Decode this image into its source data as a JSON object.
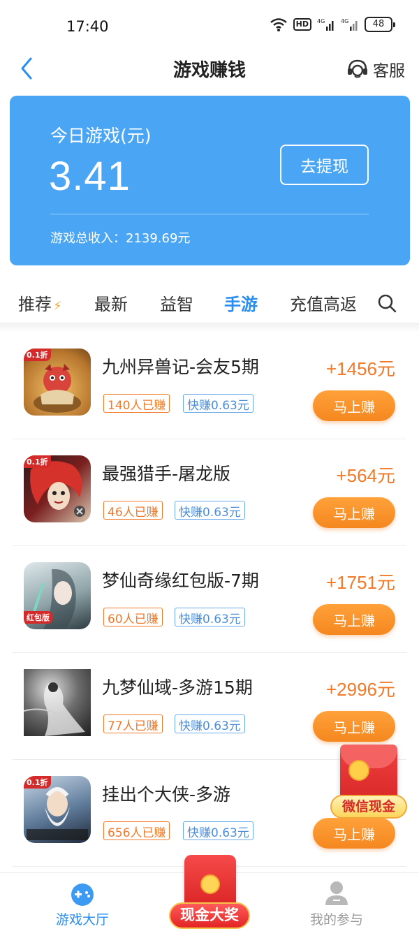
{
  "status_bar": {
    "time": "17:40",
    "battery": "48",
    "hd": "HD",
    "network1": "4G",
    "network2": "4G"
  },
  "nav": {
    "title": "游戏赚钱",
    "service_label": "客服"
  },
  "balance": {
    "label": "今日游戏(元)",
    "amount": "3.41",
    "withdraw_label": "去提现",
    "total_text": "游戏总收入：2139.69元"
  },
  "tabs": [
    {
      "label": "推荐"
    },
    {
      "label": "最新"
    },
    {
      "label": "益智"
    },
    {
      "label": "手游"
    },
    {
      "label": "充值高返"
    }
  ],
  "active_tab": "手游",
  "games": [
    {
      "title": "九州异兽记-会友5期",
      "reward": "+1456元",
      "earned": "140人已赚",
      "quick": "快赚0.63元",
      "button": "马上赚",
      "badge": "0.1折"
    },
    {
      "title": "最强猎手-屠龙版",
      "reward": "+564元",
      "earned": "46人已赚",
      "quick": "快赚0.63元",
      "button": "马上赚",
      "badge": "0.1折"
    },
    {
      "title": "梦仙奇缘红包版-7期",
      "reward": "+1751元",
      "earned": "60人已赚",
      "quick": "快赚0.63元",
      "button": "马上赚",
      "badge": "红包版"
    },
    {
      "title": "九梦仙域-多游15期",
      "reward": "+2996元",
      "earned": "77人已赚",
      "quick": "快赚0.63元",
      "button": "马上赚",
      "badge": ""
    },
    {
      "title": "挂出个大侠-多游",
      "reward": "+",
      "earned": "656人已赚",
      "quick": "快赚0.63元",
      "button": "马上赚",
      "badge": "0.1折"
    }
  ],
  "floating_promo": {
    "label": "微信现金"
  },
  "bottom_nav": {
    "hall_label": "游戏大厅",
    "center_label": "现金大奖",
    "mine_label": "我的参与"
  },
  "colors": {
    "accent_blue": "#2a8ef0",
    "card_blue": "#4aa6f4",
    "reward_orange": "#f07a2a",
    "button_orange": "#f5871f",
    "promo_red": "#d42a2a"
  }
}
